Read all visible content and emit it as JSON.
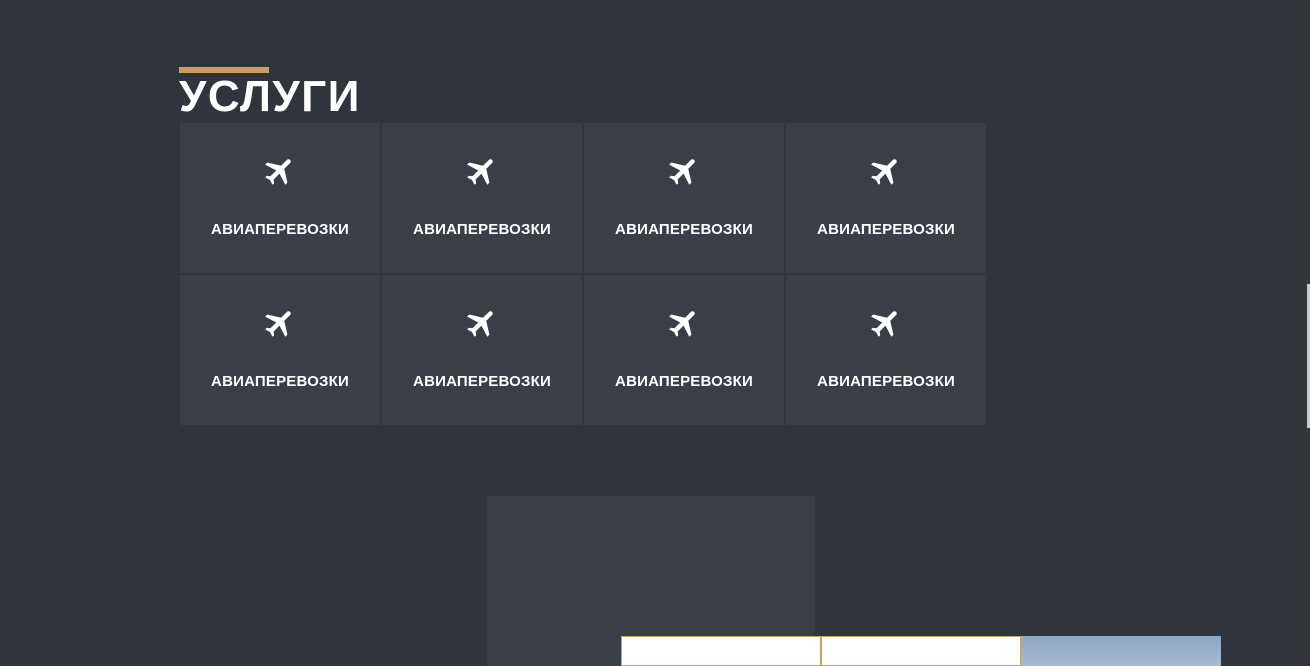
{
  "services": {
    "title": "УСЛУГИ",
    "accent_color": "#c9a15c",
    "items": [
      {
        "label": "АВИАПЕРЕВОЗКИ",
        "icon": "airplane-icon"
      },
      {
        "label": "АВИАПЕРЕВОЗКИ",
        "icon": "airplane-icon"
      },
      {
        "label": "АВИАПЕРЕВОЗКИ",
        "icon": "airplane-icon"
      },
      {
        "label": "АВИАПЕРЕВОЗКИ",
        "icon": "airplane-icon"
      },
      {
        "label": "АВИАПЕРЕВОЗКИ",
        "icon": "airplane-icon"
      },
      {
        "label": "АВИАПЕРЕВОЗКИ",
        "icon": "airplane-icon"
      },
      {
        "label": "АВИАПЕРЕВОЗКИ",
        "icon": "airplane-icon"
      },
      {
        "label": "АВИАПЕРЕВОЗКИ",
        "icon": "airplane-icon"
      }
    ]
  },
  "colors": {
    "background": "#30343c",
    "tile": "#393e47",
    "text": "#ffffff"
  }
}
